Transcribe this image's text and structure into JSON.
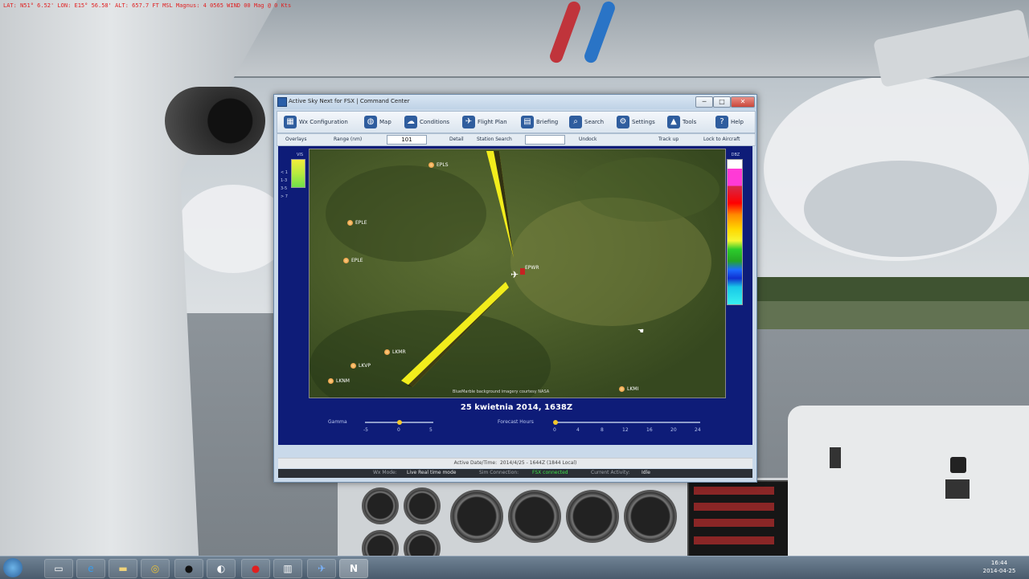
{
  "hud": {
    "text": "LAT: N51° 6.52'  LON: E15° 56.58'  ALT: 657.7 FT  MSL  Magnus: 4 0565  WIND 00 Mag @ 0 Kts"
  },
  "window": {
    "title": "Active Sky Next for FSX | Command Center",
    "controls": {
      "minimize": "─",
      "maximize": "□",
      "close": "✕"
    }
  },
  "toolbar": {
    "items": [
      {
        "label": "Wx Configuration",
        "icon": "calendar-icon",
        "glyph": "▦"
      },
      {
        "label": "Map",
        "icon": "globe-icon",
        "glyph": "◍"
      },
      {
        "label": "Conditions",
        "icon": "cloud-icon",
        "glyph": "☁"
      },
      {
        "label": "Flight Plan",
        "icon": "plane-icon",
        "glyph": "✈"
      },
      {
        "label": "Briefing",
        "icon": "document-icon",
        "glyph": "▤"
      },
      {
        "label": "Search",
        "icon": "search-icon",
        "glyph": "⌕"
      },
      {
        "label": "Settings",
        "icon": "gear-icon",
        "glyph": "⚙"
      },
      {
        "label": "Tools",
        "icon": "tools-icon",
        "glyph": "▲"
      },
      {
        "label": "Help",
        "icon": "help-icon",
        "glyph": "?"
      }
    ]
  },
  "subtoolbar": {
    "overlays": "Overlays",
    "range": "Range (nm)",
    "range_value": "101",
    "detail": "Detail",
    "station_search": "Station Search",
    "undock": "Undock",
    "track_up": "Track up",
    "lock_to_aircraft": "Lock to Aircraft"
  },
  "map": {
    "airports": [
      {
        "code": "EPLS",
        "id": "epls"
      },
      {
        "code": "EPLE",
        "id": "eple"
      },
      {
        "code": "EPLE",
        "id": "eple-2"
      },
      {
        "code": "EPWR",
        "id": "epwr"
      },
      {
        "code": "LKMR",
        "id": "lkmr"
      },
      {
        "code": "LKVP",
        "id": "lkvp"
      },
      {
        "code": "LKNM",
        "id": "lknm"
      },
      {
        "code": "LKMI",
        "id": "lkmi"
      }
    ],
    "credit": "BlueMarble background imagery courtesy NASA",
    "aircraft_label": "EPWR"
  },
  "scales": {
    "left_label": "VIS",
    "left_ticks": [
      "< 1",
      "1-3",
      "3-5",
      "> 7"
    ],
    "right_label": "DBZ"
  },
  "date_label": "25 kwietnia 2014, 1638Z",
  "sliders": {
    "gamma": {
      "label": "Gamma",
      "ticks": [
        "-5",
        "0",
        "5"
      ],
      "value": 0
    },
    "forecast": {
      "label": "Forecast Hours",
      "ticks": [
        "0",
        "4",
        "8",
        "12",
        "16",
        "20",
        "24"
      ],
      "value": 0
    }
  },
  "status": {
    "active_date_label": "Active Date/Time:",
    "active_date_value": "2014/4/25 - 1644Z (1844 Local)"
  },
  "info": {
    "wx_mode_label": "Wx Mode:",
    "wx_mode": "Live Real time mode",
    "sim_connection_label": "Sim Connection:",
    "sim_connection": "FSX connected",
    "current_activity_label": "Current Activity:",
    "current_activity": "Idle"
  },
  "taskbar": {
    "apps": [
      {
        "name": "explorer-icon",
        "glyph": "▭"
      },
      {
        "name": "internet-explorer-icon",
        "glyph": "e"
      },
      {
        "name": "folder-icon",
        "glyph": "▬"
      },
      {
        "name": "chrome-icon",
        "glyph": "◎"
      },
      {
        "name": "steam-icon",
        "glyph": "●"
      },
      {
        "name": "steam-2-icon",
        "glyph": "◐"
      },
      {
        "name": "record-icon",
        "glyph": "●"
      },
      {
        "name": "app-icon",
        "glyph": "▥"
      },
      {
        "name": "fsx-icon",
        "glyph": "✈"
      },
      {
        "name": "asn-icon",
        "glyph": "N"
      }
    ],
    "clock_time": "16:44",
    "clock_date": "2014-04-25"
  },
  "colors": {
    "accent": "#2f5d9e",
    "map_bg": "#0e1c78",
    "wind_arrow": "#f2ed1c"
  }
}
